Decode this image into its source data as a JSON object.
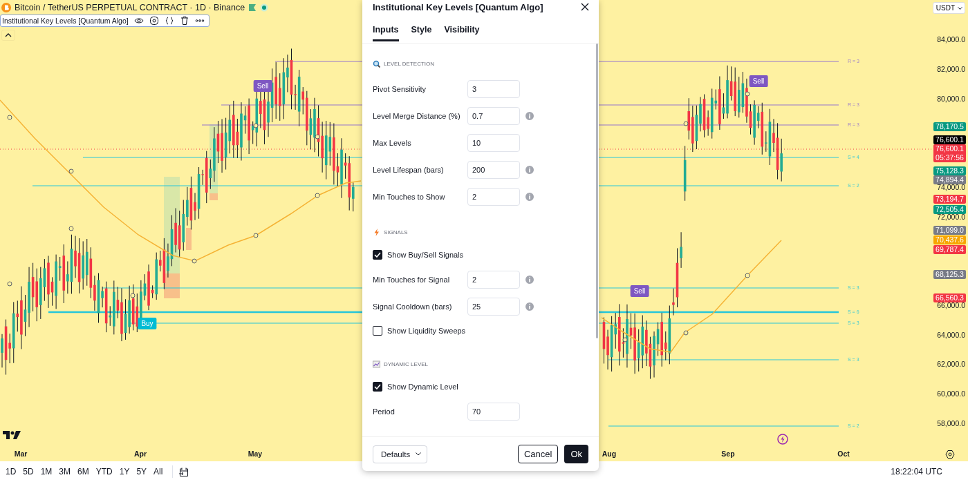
{
  "header": {
    "symbol_title": "Bitcoin / TetherUS PERPETUAL CONTRACT · 1D · Binance"
  },
  "indicator_legend": {
    "name": "Institutional Key Levels [Quantum Algo]"
  },
  "currency_button": "USDT",
  "price_ticks": [
    "84,000.0",
    "82,000.0",
    "80,000.0",
    "74,000.0",
    "72,000.0",
    "66,000.0",
    "64,000.0",
    "62,000.0",
    "60,000.0",
    "58,000.0"
  ],
  "price_tags": [
    {
      "value": "78,170.5",
      "color": "#089981"
    },
    {
      "value": "76,600.1",
      "color": "#000000"
    },
    {
      "value": "76,600.1",
      "countdown": "05:37:56",
      "color": "#f23645"
    },
    {
      "value": "75,128.3",
      "color": "#089981"
    },
    {
      "value": "74,894.4",
      "color": "#787b86"
    },
    {
      "value": "73,194.7",
      "color": "#f23645"
    },
    {
      "value": "72,505.4",
      "color": "#089981"
    },
    {
      "value": "71,099.0",
      "color": "#787b86"
    },
    {
      "value": "70,437.6",
      "color": "#f7a600"
    },
    {
      "value": "69,787.4",
      "color": "#f23645"
    },
    {
      "value": "68,125.3",
      "color": "#787b86"
    },
    {
      "value": "66,560.3",
      "color": "#f23645"
    }
  ],
  "levels": [
    {
      "label": "R = 3",
      "kind": "resistance"
    },
    {
      "label": "R = 3",
      "kind": "resistance"
    },
    {
      "label": "R = 3",
      "kind": "resistance"
    },
    {
      "label": "S = 4",
      "kind": "support"
    },
    {
      "label": "S = 2",
      "kind": "support"
    },
    {
      "label": "S = 3",
      "kind": "support"
    },
    {
      "label": "S = 6",
      "kind": "support"
    },
    {
      "label": "S = 3",
      "kind": "support"
    },
    {
      "label": "S = 3",
      "kind": "support"
    },
    {
      "label": "S = 2",
      "kind": "support"
    }
  ],
  "signals": [
    {
      "label": "Sell",
      "kind": "sell"
    },
    {
      "label": "Buy",
      "kind": "buy"
    },
    {
      "label": "Sell",
      "kind": "sell"
    },
    {
      "label": "Sell",
      "kind": "sell"
    }
  ],
  "time_axis": [
    "Mar",
    "Apr",
    "May",
    "Aug",
    "Sep",
    "Oct"
  ],
  "range_buttons": [
    "1D",
    "5D",
    "1M",
    "3M",
    "6M",
    "YTD",
    "1Y",
    "5Y",
    "All"
  ],
  "clock": "18:22:04 UTC",
  "dialog": {
    "title": "Institutional Key Levels [Quantum Algo]",
    "tabs": [
      {
        "label": "Inputs",
        "selected": true
      },
      {
        "label": "Style",
        "selected": false
      },
      {
        "label": "Visibility",
        "selected": false
      }
    ],
    "sections": [
      {
        "title": "LEVEL DETECTION",
        "fields": [
          {
            "kind": "number",
            "label": "Pivot Sensitivity",
            "value": "3",
            "info": false
          },
          {
            "kind": "number",
            "label": "Level Merge Distance (%)",
            "value": "0.7",
            "info": true
          },
          {
            "kind": "number",
            "label": "Max Levels",
            "value": "10",
            "info": false
          },
          {
            "kind": "number",
            "label": "Level Lifespan (bars)",
            "value": "200",
            "info": true
          },
          {
            "kind": "number",
            "label": "Min Touches to Show",
            "value": "2",
            "info": true
          }
        ]
      },
      {
        "title": "SIGNALS",
        "fields": [
          {
            "kind": "checkbox",
            "label": "Show Buy/Sell Signals",
            "checked": true
          },
          {
            "kind": "number",
            "label": "Min Touches for Signal",
            "value": "2",
            "info": true
          },
          {
            "kind": "number",
            "label": "Signal Cooldown (bars)",
            "value": "25",
            "info": true
          },
          {
            "kind": "checkbox",
            "label": "Show Liquidity Sweeps",
            "checked": false
          }
        ]
      },
      {
        "title": "DYNAMIC LEVEL",
        "fields": [
          {
            "kind": "checkbox",
            "label": "Show Dynamic Level",
            "checked": true
          },
          {
            "kind": "number",
            "label": "Period",
            "value": "70",
            "info": false
          }
        ]
      }
    ],
    "defaults_button": "Defaults",
    "cancel_button": "Cancel",
    "ok_button": "Ok"
  }
}
